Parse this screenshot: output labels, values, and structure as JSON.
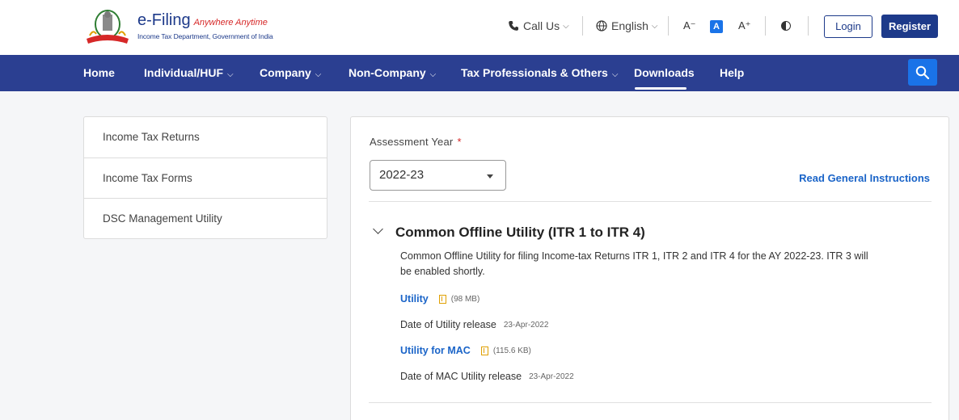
{
  "header": {
    "brand_title": "e-Filing",
    "brand_tagline": "Anywhere Anytime",
    "brand_subtitle": "Income Tax Department, Government of India",
    "call_us": "Call Us",
    "language": "English",
    "font_decrease": "A⁻",
    "font_normal": "A",
    "font_increase": "A⁺",
    "login_label": "Login",
    "register_label": "Register"
  },
  "nav": {
    "items": [
      {
        "label": "Home"
      },
      {
        "label": "Individual/HUF"
      },
      {
        "label": "Company"
      },
      {
        "label": "Non-Company"
      },
      {
        "label": "Tax Professionals & Others"
      },
      {
        "label": "Downloads"
      },
      {
        "label": "Help"
      }
    ],
    "active": "Downloads"
  },
  "sidebar": {
    "items": [
      {
        "label": "Income Tax Returns"
      },
      {
        "label": "Income Tax Forms"
      },
      {
        "label": "DSC Management Utility"
      }
    ]
  },
  "main": {
    "assessment_year_label": "Assessment Year",
    "required_mark": "*",
    "assessment_year_value": "2022-23",
    "read_instructions": "Read General Instructions",
    "section": {
      "title": "Common Offline Utility (ITR 1 to ITR 4)",
      "description": "Common Offline Utility for filing Income-tax Returns ITR 1, ITR 2 and ITR 4 for the AY 2022-23. ITR 3 will be enabled shortly.",
      "utility_label": "Utility",
      "utility_size": "(98 MB)",
      "release_label": "Date of Utility release",
      "release_date": "23-Apr-2022",
      "mac_label": "Utility for MAC",
      "mac_size": "(115.6 KB)",
      "mac_release_label": "Date of MAC Utility release",
      "mac_release_date": "23-Apr-2022"
    }
  },
  "colors": {
    "nav_bg": "#2b3f91",
    "accent": "#1a73e8",
    "link": "#1a64c8",
    "brand": "#1d3a8a"
  },
  "icons": [
    "emblem-logo",
    "phone-icon",
    "globe-icon",
    "contrast-icon",
    "search-icon",
    "chevron-down-icon",
    "download-icon"
  ]
}
